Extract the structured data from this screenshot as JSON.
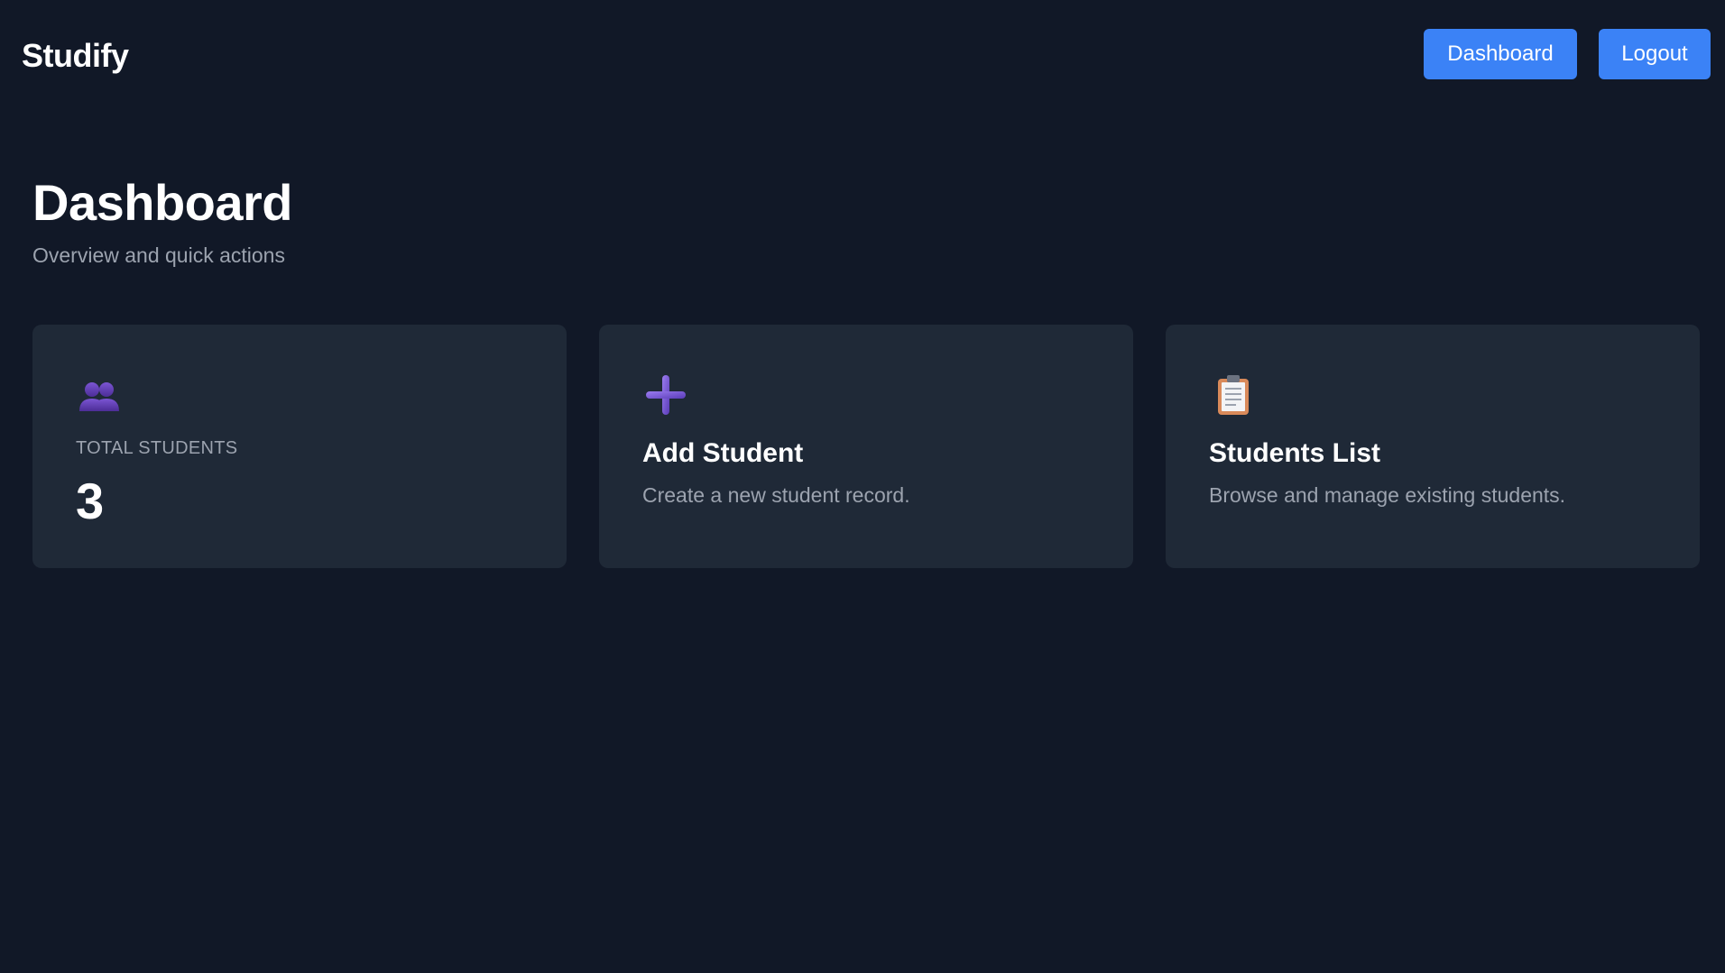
{
  "navbar": {
    "brand": "Studify",
    "dashboard_label": "Dashboard",
    "logout_label": "Logout",
    "button_color": "#3b82f6"
  },
  "header": {
    "title": "Dashboard",
    "subtitle": "Overview and quick actions"
  },
  "cards": {
    "total_students": {
      "icon": "users-icon",
      "label": "TOTAL STUDENTS",
      "value": "3"
    },
    "add_student": {
      "icon": "plus-icon",
      "title": "Add Student",
      "description": "Create a new student record."
    },
    "students_list": {
      "icon": "clipboard-icon",
      "title": "Students List",
      "description": "Browse and manage existing students."
    }
  },
  "colors": {
    "background": "#111827",
    "card": "#1f2937",
    "muted_text": "#9ca3af",
    "icon_purple": "#7c5cd6"
  }
}
